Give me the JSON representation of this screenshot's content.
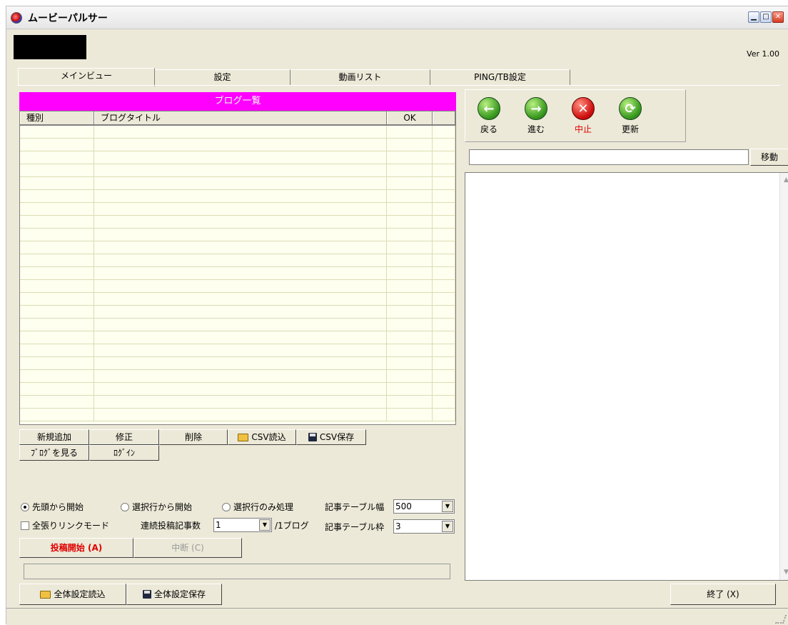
{
  "window": {
    "title": "ムービーパルサー",
    "version": "Ver 1.00"
  },
  "tabs": [
    "メインビュー",
    "設定",
    "動画リスト",
    "PING/TB設定"
  ],
  "blog_list": {
    "title": "ブログ一覧",
    "columns": [
      "種別",
      "ブログタイトル",
      "OK",
      ""
    ]
  },
  "buttons": {
    "add": "新規追加",
    "edit": "修正",
    "delete": "削除",
    "csv_load": "CSV読込",
    "csv_save": "CSV保存",
    "view_blog": "ﾌﾞﾛｸﾞを見る",
    "login": "ﾛｸﾞｲﾝ",
    "post_start": "投稿開始 (A)",
    "interrupt": "中断 (C)",
    "load_all": "全体設定読込",
    "save_all": "全体設定保存",
    "exit": "終了 (X)"
  },
  "options": {
    "start_top": "先頭から開始",
    "start_selected": "選択行から開始",
    "selected_only": "選択行のみ処理",
    "table_width_label": "記事テーブル幅",
    "table_width_value": "500",
    "all_link_mode": "全張りリンクモード",
    "consecutive_label": "連続投稿記事数",
    "consecutive_value": "1",
    "per_blog": "/1ブログ",
    "table_border_label": "記事テーブル枠",
    "table_border_value": "3"
  },
  "browser": {
    "back": "戻る",
    "forward": "進む",
    "stop": "中止",
    "refresh": "更新",
    "go": "移動"
  },
  "colors": {
    "list_header": "#ff00ff",
    "post_start_text": "#e00000",
    "stop_text": "#e00000"
  }
}
